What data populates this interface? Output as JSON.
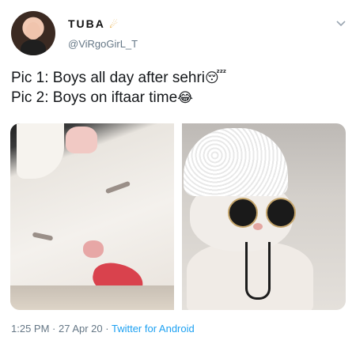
{
  "user": {
    "display_name": "TUBA",
    "badge": "☄",
    "handle": "@ViRgoGirL_T"
  },
  "tweet": {
    "line1_text": "Pic 1: Boys all day after sehri",
    "line1_emoji": "😴",
    "line2_text": "Pic 2: Boys on iftaar time",
    "line2_emoji": "😂"
  },
  "meta": {
    "time": "1:25 PM",
    "separator": " · ",
    "date": "27 Apr 20",
    "separator2": " · ",
    "source": "Twitter for Android"
  },
  "icons": {
    "menu": "chevron-down-icon"
  }
}
